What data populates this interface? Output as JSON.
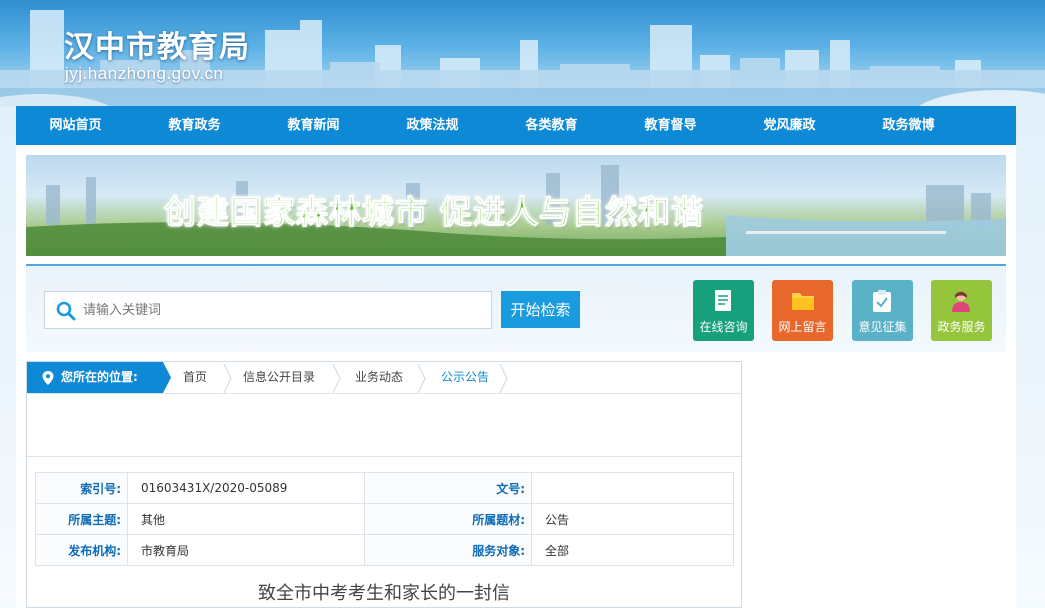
{
  "header": {
    "site_title": "汉中市教育局",
    "site_url": "jyj.hanzhong.gov.cn"
  },
  "nav": {
    "items": [
      "网站首页",
      "教育政务",
      "教育新闻",
      "政策法规",
      "各类教育",
      "教育督导",
      "党风廉政",
      "政务微博"
    ]
  },
  "banner": {
    "slogan": "创建国家森林城市  促进人与自然和谐"
  },
  "search": {
    "placeholder": "请输入关键词",
    "button_label": "开始检索"
  },
  "services": [
    {
      "label": "在线咨询",
      "color": "#17a07c",
      "icon": "document-icon"
    },
    {
      "label": "网上留言",
      "color": "#e8672b",
      "icon": "folder-icon"
    },
    {
      "label": "意见征集",
      "color": "#5ab2c9",
      "icon": "clipboard-icon"
    },
    {
      "label": "政务服务",
      "color": "#94c53a",
      "icon": "person-icon"
    }
  ],
  "breadcrumb": {
    "label": "您所在的位置:",
    "items": [
      "首页",
      "信息公开目录",
      "业务动态",
      "公示公告"
    ]
  },
  "info": {
    "index_label": "索引号:",
    "index_value": "01603431X/2020-05089",
    "docno_label": "文号:",
    "docno_value": "",
    "topic_label": "所属主题:",
    "topic_value": "其他",
    "genre_label": "所属题材:",
    "genre_value": "公告",
    "org_label": "发布机构:",
    "org_value": "市教育局",
    "target_label": "服务对象:",
    "target_value": "全部"
  },
  "article": {
    "title": "致全市中考考生和家长的一封信"
  },
  "colors": {
    "nav_blue": "#0e89d6",
    "label_blue": "#0e6cb8",
    "search_button": "#1a9be0"
  }
}
